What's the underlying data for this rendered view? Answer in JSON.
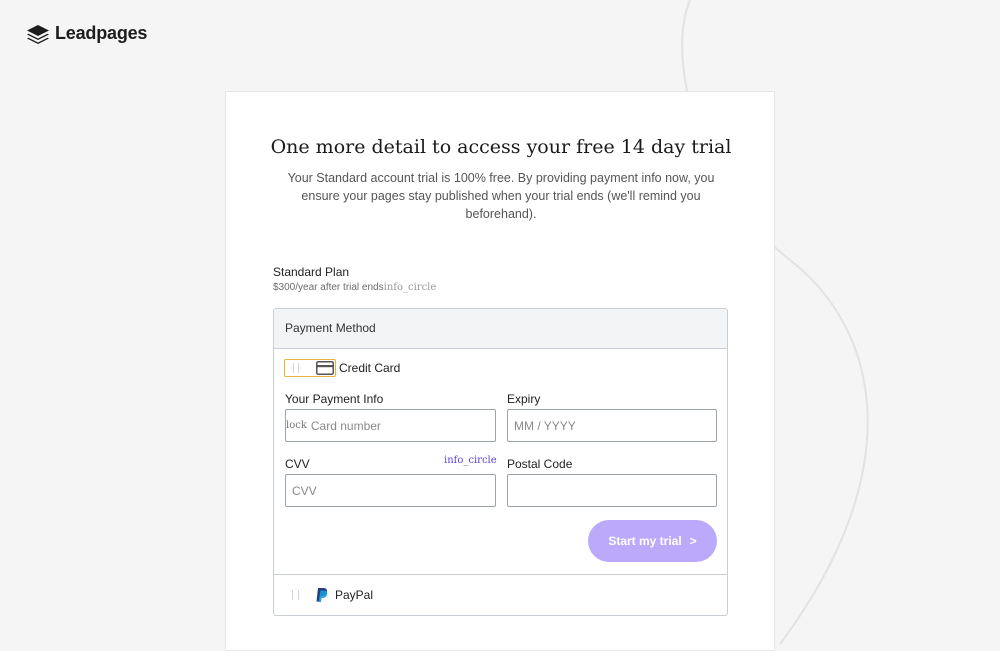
{
  "brand": {
    "name": "Leadpages"
  },
  "main": {
    "title": "One more detail to access your free 14 day trial",
    "subtitle": "Your Standard account trial is 100% free. By providing payment info now, you ensure your pages stay published when your trial ends (we'll remind you beforehand)."
  },
  "plan": {
    "name": "Standard Plan",
    "price": "$300/year after trial ends",
    "info_icon_text": "info_circle"
  },
  "payment": {
    "header": "Payment Method",
    "credit_card_label": "Credit Card",
    "payment_info_label": "Your Payment Info",
    "card_number_prefix": "lock",
    "card_number_placeholder": "Card number",
    "expiry_label": "Expiry",
    "expiry_placeholder": "MM / YYYY",
    "cvv_label": "CVV",
    "cvv_info_text": "info_circle",
    "cvv_placeholder": "CVV",
    "postal_label": "Postal Code",
    "postal_placeholder": "",
    "submit_label": "Start my trial",
    "submit_chevron": ">",
    "paypal_label": "PayPal"
  },
  "colors": {
    "accent_button": "#bbaafa",
    "info_link": "#5b43d6",
    "selected_border": "#e7b43a",
    "background": "#f5f5f5"
  },
  "icons": [
    "layers-logo-icon",
    "credit-card-icon",
    "paypal-icon"
  ]
}
